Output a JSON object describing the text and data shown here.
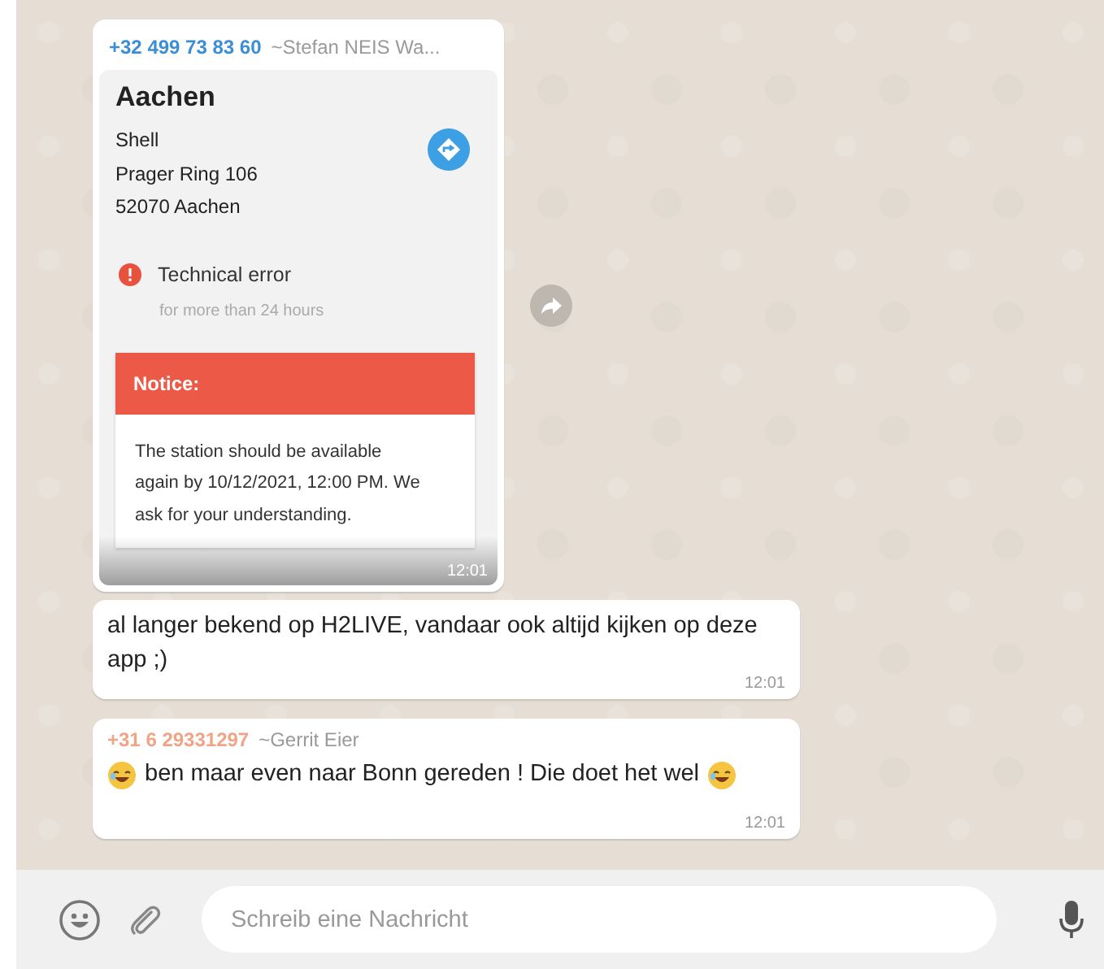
{
  "messages": [
    {
      "kind": "image",
      "sender": {
        "phone": "+32 499 73 83 60",
        "name": "~Stefan NEIS Wa...",
        "color": "#3b8ed6"
      },
      "forward": true,
      "screenshot": {
        "title": "Aachen",
        "address": [
          "Shell",
          "Prager Ring 106",
          "52070 Aachen"
        ],
        "status": "Technical error",
        "status_detail": "for more than 24 hours",
        "notice_title": "Notice:",
        "notice_text": "The station should be available again by 10/12/2021, 12:00 PM. We ask for your understanding."
      },
      "time": "12:01"
    },
    {
      "kind": "text",
      "parts": [
        {
          "kind": "text",
          "text": "al langer bekend op H2LIVE, vandaar ook altijd kijken op deze app ;)"
        }
      ],
      "time": "12:01"
    },
    {
      "kind": "text",
      "sender": {
        "phone": "+31 6 29331297",
        "name": "~Gerrit Eier",
        "color": "#f0a486"
      },
      "parts": [
        {
          "kind": "emoji"
        },
        {
          "kind": "text",
          "text": "ben maar even naar Bonn gereden ! Die doet het wel"
        },
        {
          "kind": "emoji"
        }
      ],
      "time": "12:01"
    }
  ],
  "composer": {
    "placeholder": "Schreib eine Nachricht"
  }
}
